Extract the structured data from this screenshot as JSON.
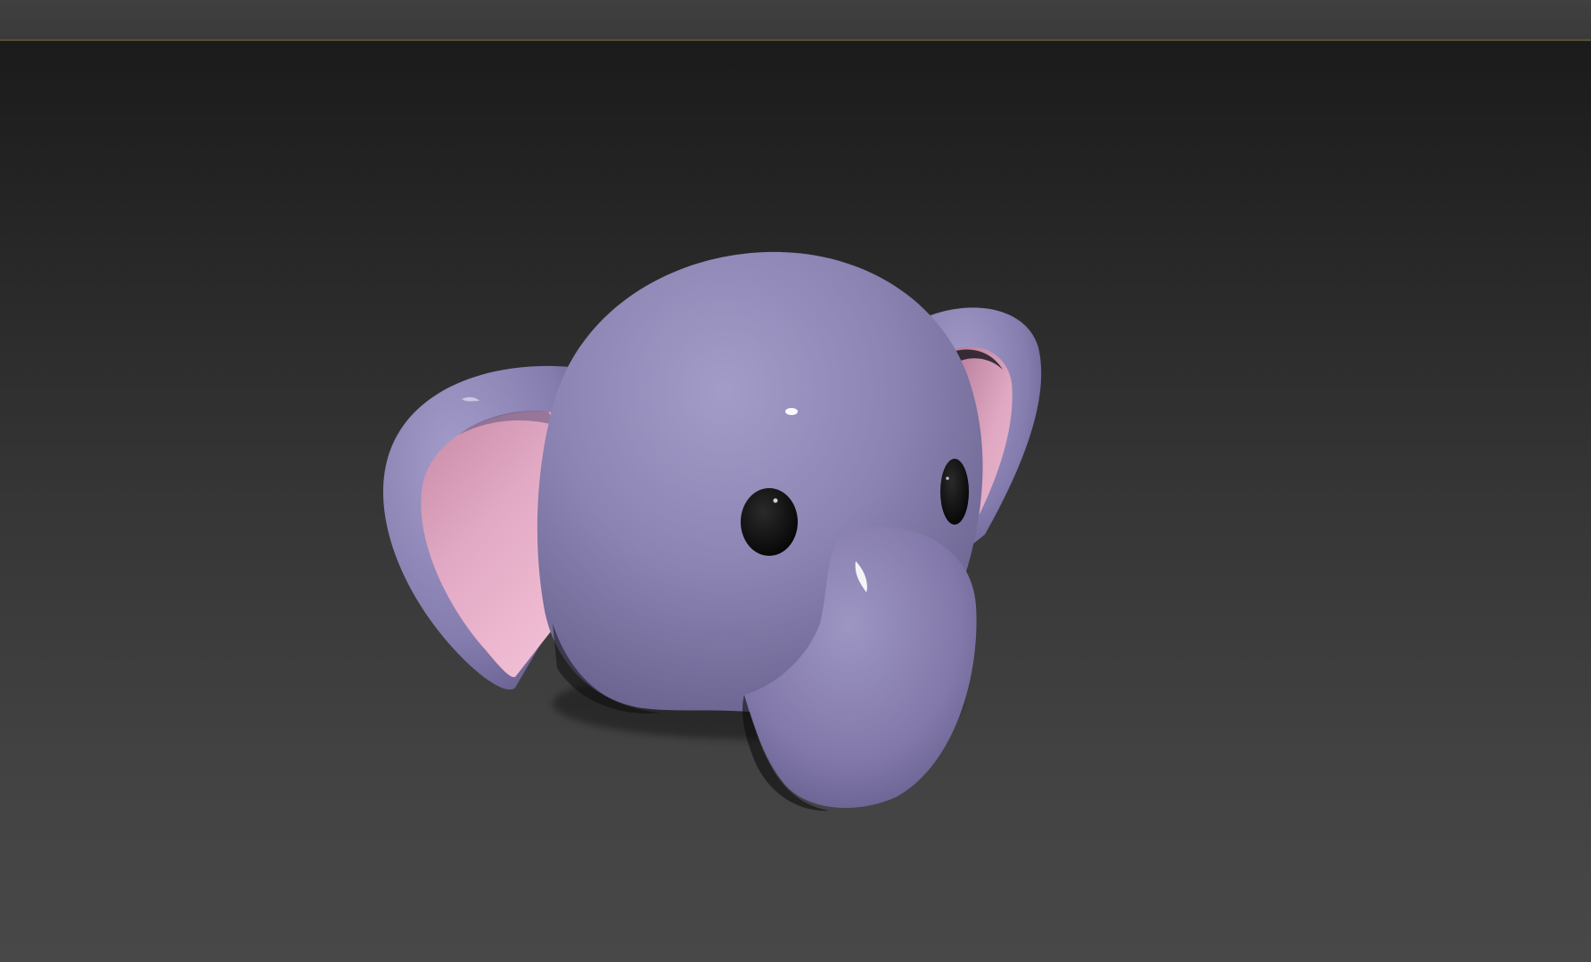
{
  "viewport": {
    "background_top": "#1b1b1b",
    "background_bottom": "#484848",
    "model": {
      "subject": "elephant-head",
      "body_color": "#8a82b0",
      "ear_inner_color": "#e8b0c8",
      "eye_color": "#0a0a0a",
      "shading": "smooth-shaded"
    }
  }
}
